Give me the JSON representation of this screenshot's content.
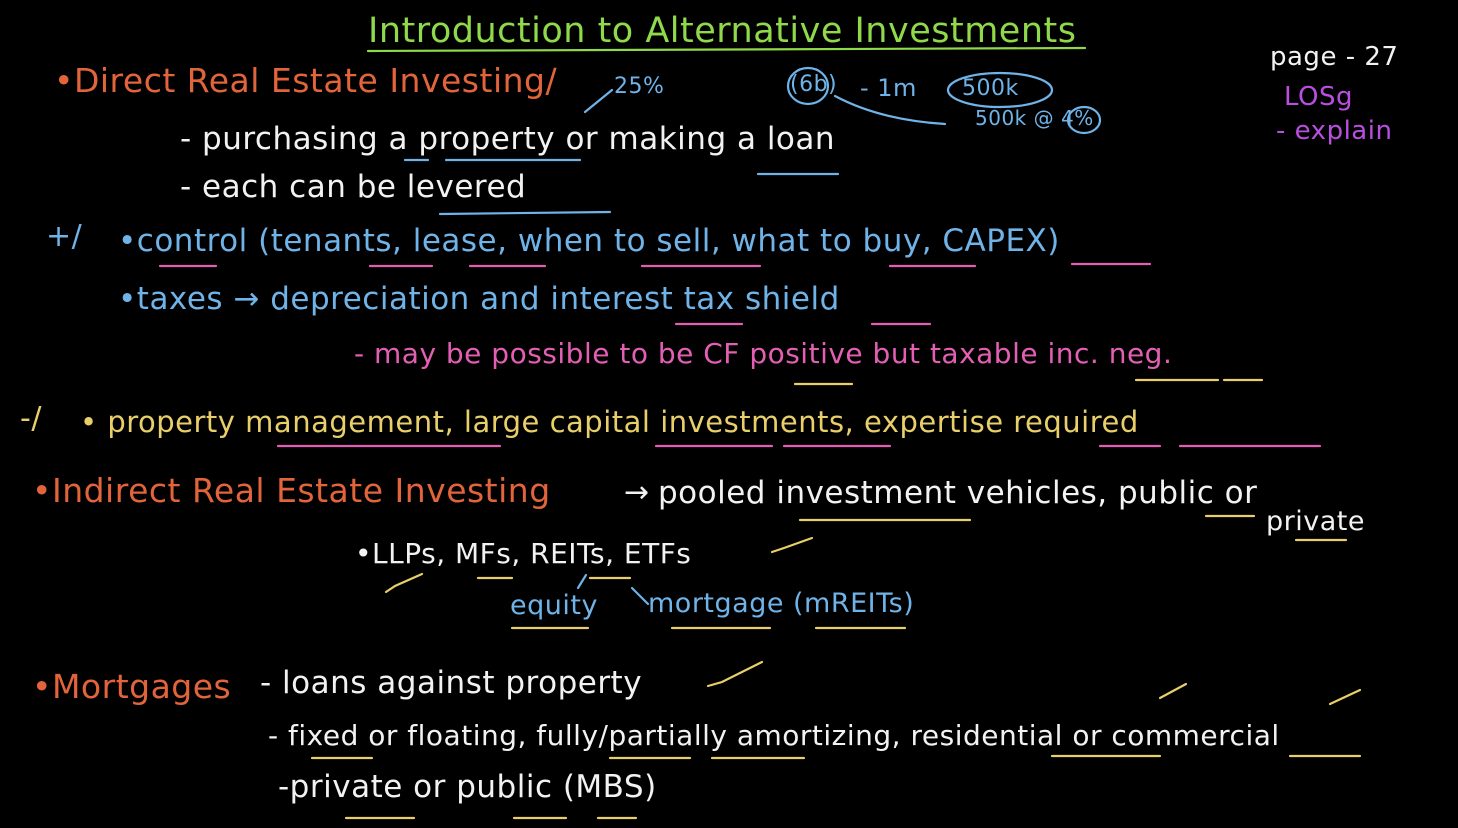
{
  "colors": {
    "green": "#8fd94a",
    "orange": "#e2643b",
    "white": "#f2f2f2",
    "blue": "#6fb3e8",
    "pink": "#e35fb4",
    "yellow": "#e8cf6a",
    "purple": "#b84fe0"
  },
  "title": "Introduction to Alternative Investments",
  "page_note": {
    "page": "page - 27",
    "los": "LOSg",
    "explain": "- explain"
  },
  "direct": {
    "heading": "•Direct Real Estate Investing/",
    "pct": "25%",
    "example_left": "(6b)",
    "example_mid": "- 1m",
    "example_right": "500k",
    "example_sub": "500k @ 4%",
    "bullet1": "- purchasing a property or making a loan",
    "bullet2": "- each can be levered",
    "plus": "+/",
    "control": "•control (tenants, lease, when to sell, what to buy, CAPEX)",
    "taxes": "•taxes → depreciation and interest tax shield",
    "taxes_note": "- may be possible to be CF positive but taxable inc. neg.",
    "minus": "-/",
    "minus_text": "• property management, large capital investments, expertise required"
  },
  "indirect": {
    "heading": "•Indirect Real Estate Investing",
    "arrow": "→",
    "text": "pooled investment vehicles, public or",
    "text2": "private",
    "vehicles": "•LLPs, MFs, REITs, ETFs",
    "equity": "equity",
    "mortgage": "mortgage (mREITs)"
  },
  "mortgages": {
    "heading": "•Mortgages",
    "line1": "- loans against property",
    "line2": "- fixed or floating, fully/partially amortizing, residential or commercial",
    "line3": "-private or public (MBS)"
  }
}
